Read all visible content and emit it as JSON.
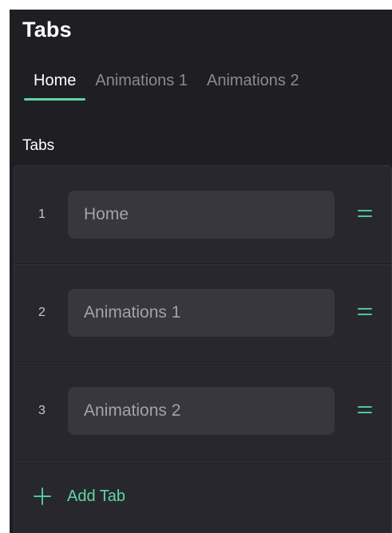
{
  "header": {
    "title": "Tabs"
  },
  "tabs": [
    {
      "label": "Home",
      "active": true
    },
    {
      "label": "Animations 1",
      "active": false
    },
    {
      "label": "Animations 2",
      "active": false
    }
  ],
  "section": {
    "label": "Tabs"
  },
  "rows": [
    {
      "index": "1",
      "value": "Home"
    },
    {
      "index": "2",
      "value": "Animations 1"
    },
    {
      "index": "3",
      "value": "Animations 2"
    }
  ],
  "add_button": {
    "label": "Add Tab"
  },
  "colors": {
    "background": "#1f1e23",
    "list_background": "#28272e",
    "field_background": "#38373f",
    "accent": "#5dd6a5"
  },
  "icons": {
    "drag": "drag-handle-icon",
    "add": "plus-icon"
  }
}
